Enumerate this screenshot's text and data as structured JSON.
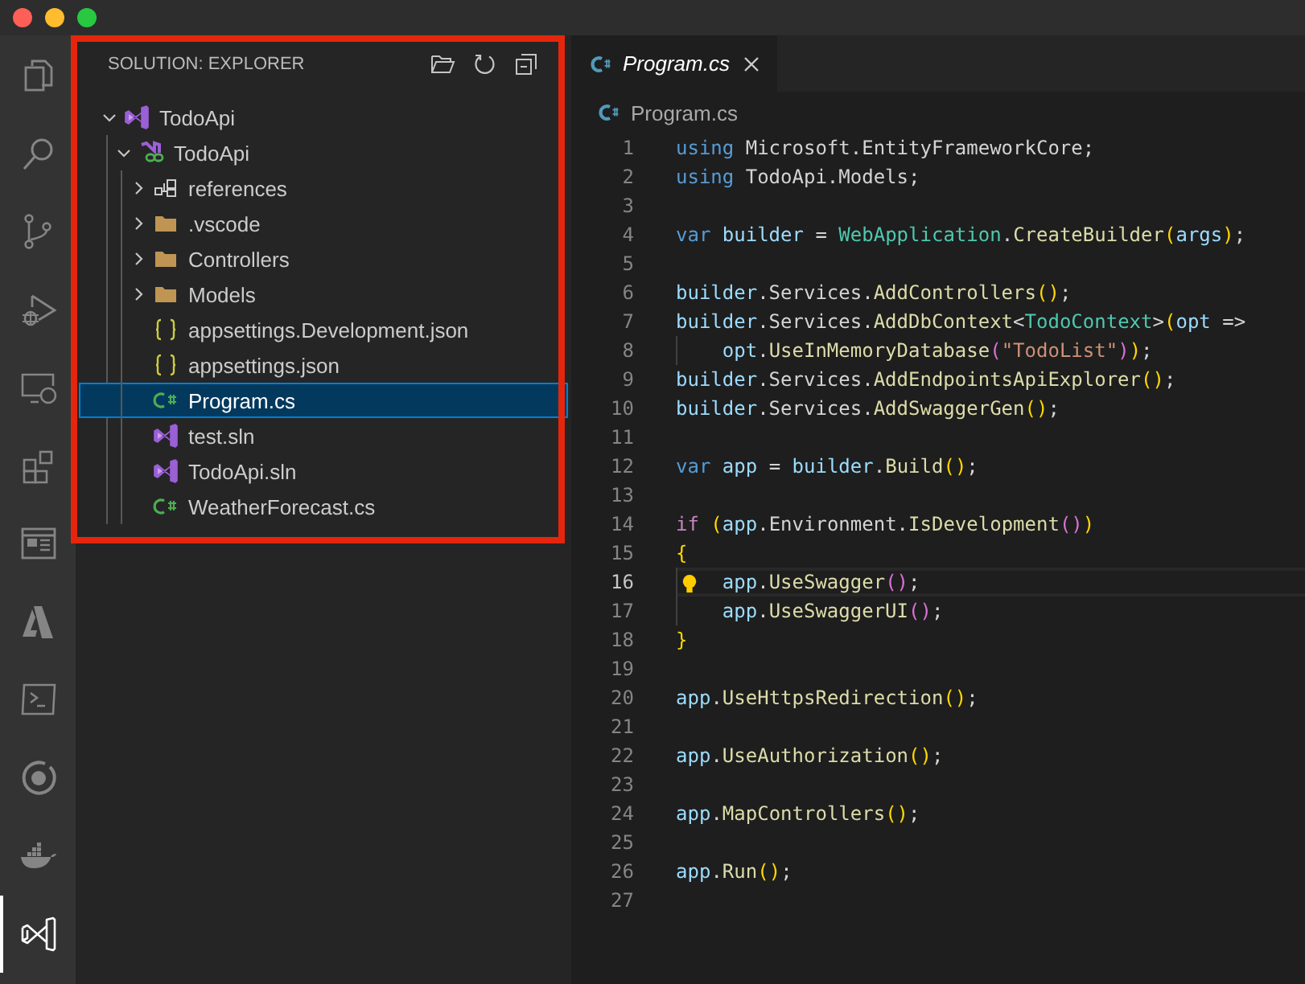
{
  "activity_bar": [
    {
      "kind": "files",
      "selected": false
    },
    {
      "kind": "search",
      "selected": false
    },
    {
      "kind": "source-control",
      "selected": false
    },
    {
      "kind": "run-debug",
      "selected": false
    },
    {
      "kind": "remote",
      "selected": false
    },
    {
      "kind": "extensions",
      "selected": false
    },
    {
      "kind": "layout",
      "selected": false
    },
    {
      "kind": "azure",
      "selected": false
    },
    {
      "kind": "terminal",
      "selected": false
    },
    {
      "kind": "ring",
      "selected": false
    },
    {
      "kind": "docker",
      "selected": false
    },
    {
      "kind": "solution",
      "selected": true
    }
  ],
  "sidebar": {
    "title": "SOLUTION: EXPLORER",
    "tree": [
      {
        "label": "TodoApi",
        "kind": "solution",
        "expanded": true,
        "selected": false,
        "children": [
          {
            "label": "TodoApi",
            "kind": "project",
            "expanded": true,
            "selected": false,
            "children": [
              {
                "label": "references",
                "kind": "references",
                "expanded": false,
                "selected": false
              },
              {
                "label": ".vscode",
                "kind": "folder",
                "expanded": false,
                "selected": false
              },
              {
                "label": "Controllers",
                "kind": "folder",
                "expanded": false,
                "selected": false
              },
              {
                "label": "Models",
                "kind": "folder",
                "expanded": false,
                "selected": false
              },
              {
                "label": "appsettings.Development.json",
                "kind": "json",
                "selected": false
              },
              {
                "label": "appsettings.json",
                "kind": "json",
                "selected": false
              },
              {
                "label": "Program.cs",
                "kind": "csharp",
                "selected": true
              },
              {
                "label": "test.sln",
                "kind": "solution",
                "selected": false
              },
              {
                "label": "TodoApi.sln",
                "kind": "solution",
                "selected": false
              },
              {
                "label": "WeatherForecast.cs",
                "kind": "csharp",
                "selected": false
              }
            ]
          }
        ]
      }
    ]
  },
  "editor": {
    "tabs": [
      {
        "label": "Program.cs",
        "selected": true
      }
    ],
    "breadcrumb": "Program.cs",
    "lines": [
      {
        "number": "1",
        "current": false,
        "indented": false,
        "tokens": [
          {
            "text": "using",
            "kind": "keyword"
          },
          {
            "text": " Microsoft.EntityFrameworkCore;",
            "kind": "plain"
          }
        ]
      },
      {
        "number": "2",
        "current": false,
        "indented": false,
        "tokens": [
          {
            "text": "using",
            "kind": "keyword"
          },
          {
            "text": " TodoApi.Models;",
            "kind": "plain"
          }
        ]
      },
      {
        "number": "3",
        "current": false,
        "indented": false
      },
      {
        "number": "4",
        "current": false,
        "indented": false,
        "tokens": [
          {
            "text": "var",
            "kind": "keyword"
          },
          {
            "text": " builder",
            "kind": "variable"
          },
          {
            "text": " = ",
            "kind": "plain"
          },
          {
            "text": "WebApplication",
            "kind": "type"
          },
          {
            "text": ".",
            "kind": "plain"
          },
          {
            "text": "CreateBuilder",
            "kind": "method"
          },
          {
            "text": "(",
            "kind": "bracket"
          },
          {
            "text": "args",
            "kind": "variable"
          },
          {
            "text": ")",
            "kind": "bracket"
          },
          {
            "text": ";",
            "kind": "plain"
          }
        ]
      },
      {
        "number": "5",
        "current": false,
        "indented": false
      },
      {
        "number": "6",
        "current": false,
        "indented": false,
        "tokens": [
          {
            "text": "builder",
            "kind": "variable"
          },
          {
            "text": ".Services.",
            "kind": "plain"
          },
          {
            "text": "AddControllers",
            "kind": "method"
          },
          {
            "text": "()",
            "kind": "bracket"
          },
          {
            "text": ";",
            "kind": "plain"
          }
        ]
      },
      {
        "number": "7",
        "current": false,
        "indented": false,
        "tokens": [
          {
            "text": "builder",
            "kind": "variable"
          },
          {
            "text": ".Services.",
            "kind": "plain"
          },
          {
            "text": "AddDbContext",
            "kind": "method"
          },
          {
            "text": "<",
            "kind": "plain"
          },
          {
            "text": "TodoContext",
            "kind": "type"
          },
          {
            "text": ">",
            "kind": "plain"
          },
          {
            "text": "(",
            "kind": "bracket"
          },
          {
            "text": "opt",
            "kind": "variable"
          },
          {
            "text": " =>",
            "kind": "plain"
          }
        ]
      },
      {
        "number": "8",
        "current": false,
        "indented": true,
        "tokens": [
          {
            "text": "opt",
            "kind": "variable"
          },
          {
            "text": ".",
            "kind": "plain"
          },
          {
            "text": "UseInMemoryDatabase",
            "kind": "method"
          },
          {
            "text": "(",
            "kind": "bracket2"
          },
          {
            "text": "\"TodoList\"",
            "kind": "string"
          },
          {
            "text": ")",
            "kind": "bracket2"
          },
          {
            "text": ")",
            "kind": "bracket"
          },
          {
            "text": ";",
            "kind": "plain"
          }
        ]
      },
      {
        "number": "9",
        "current": false,
        "indented": false,
        "tokens": [
          {
            "text": "builder",
            "kind": "variable"
          },
          {
            "text": ".Services.",
            "kind": "plain"
          },
          {
            "text": "AddEndpointsApiExplorer",
            "kind": "method"
          },
          {
            "text": "()",
            "kind": "bracket"
          },
          {
            "text": ";",
            "kind": "plain"
          }
        ]
      },
      {
        "number": "10",
        "current": false,
        "indented": false,
        "tokens": [
          {
            "text": "builder",
            "kind": "variable"
          },
          {
            "text": ".Services.",
            "kind": "plain"
          },
          {
            "text": "AddSwaggerGen",
            "kind": "method"
          },
          {
            "text": "()",
            "kind": "bracket"
          },
          {
            "text": ";",
            "kind": "plain"
          }
        ]
      },
      {
        "number": "11",
        "current": false,
        "indented": false
      },
      {
        "number": "12",
        "current": false,
        "indented": false,
        "tokens": [
          {
            "text": "var",
            "kind": "keyword"
          },
          {
            "text": " app",
            "kind": "variable"
          },
          {
            "text": " = ",
            "kind": "plain"
          },
          {
            "text": "builder",
            "kind": "variable"
          },
          {
            "text": ".",
            "kind": "plain"
          },
          {
            "text": "Build",
            "kind": "method"
          },
          {
            "text": "()",
            "kind": "bracket"
          },
          {
            "text": ";",
            "kind": "plain"
          }
        ]
      },
      {
        "number": "13",
        "current": false,
        "indented": false
      },
      {
        "number": "14",
        "current": false,
        "indented": false,
        "tokens": [
          {
            "text": "if",
            "kind": "control"
          },
          {
            "text": " (",
            "kind": "bracket"
          },
          {
            "text": "app",
            "kind": "variable"
          },
          {
            "text": ".Environment.",
            "kind": "plain"
          },
          {
            "text": "IsDevelopment",
            "kind": "method"
          },
          {
            "text": "()",
            "kind": "bracket2"
          },
          {
            "text": ")",
            "kind": "bracket"
          }
        ]
      },
      {
        "number": "15",
        "current": false,
        "indented": false,
        "tokens": [
          {
            "text": "{",
            "kind": "bracket"
          }
        ]
      },
      {
        "number": "16",
        "current": true,
        "indented": true,
        "tokens": [
          {
            "text": "app",
            "kind": "variable"
          },
          {
            "text": ".",
            "kind": "plain"
          },
          {
            "text": "UseSwagger",
            "kind": "method"
          },
          {
            "text": "()",
            "kind": "bracket2"
          },
          {
            "text": ";",
            "kind": "plain"
          }
        ]
      },
      {
        "number": "17",
        "current": false,
        "indented": true,
        "tokens": [
          {
            "text": "app",
            "kind": "variable"
          },
          {
            "text": ".",
            "kind": "plain"
          },
          {
            "text": "UseSwaggerUI",
            "kind": "method"
          },
          {
            "text": "()",
            "kind": "bracket2"
          },
          {
            "text": ";",
            "kind": "plain"
          }
        ]
      },
      {
        "number": "18",
        "current": false,
        "indented": false,
        "tokens": [
          {
            "text": "}",
            "kind": "bracket"
          }
        ]
      },
      {
        "number": "19",
        "current": false,
        "indented": false
      },
      {
        "number": "20",
        "current": false,
        "indented": false,
        "tokens": [
          {
            "text": "app",
            "kind": "variable"
          },
          {
            "text": ".",
            "kind": "plain"
          },
          {
            "text": "UseHttpsRedirection",
            "kind": "method"
          },
          {
            "text": "()",
            "kind": "bracket"
          },
          {
            "text": ";",
            "kind": "plain"
          }
        ]
      },
      {
        "number": "21",
        "current": false,
        "indented": false
      },
      {
        "number": "22",
        "current": false,
        "indented": false,
        "tokens": [
          {
            "text": "app",
            "kind": "variable"
          },
          {
            "text": ".",
            "kind": "plain"
          },
          {
            "text": "UseAuthorization",
            "kind": "method"
          },
          {
            "text": "()",
            "kind": "bracket"
          },
          {
            "text": ";",
            "kind": "plain"
          }
        ]
      },
      {
        "number": "23",
        "current": false,
        "indented": false
      },
      {
        "number": "24",
        "current": false,
        "indented": false,
        "tokens": [
          {
            "text": "app",
            "kind": "variable"
          },
          {
            "text": ".",
            "kind": "plain"
          },
          {
            "text": "MapControllers",
            "kind": "method"
          },
          {
            "text": "()",
            "kind": "bracket"
          },
          {
            "text": ";",
            "kind": "plain"
          }
        ]
      },
      {
        "number": "25",
        "current": false,
        "indented": false
      },
      {
        "number": "26",
        "current": false,
        "indented": false,
        "tokens": [
          {
            "text": "app",
            "kind": "variable"
          },
          {
            "text": ".",
            "kind": "plain"
          },
          {
            "text": "Run",
            "kind": "method"
          },
          {
            "text": "()",
            "kind": "bracket"
          },
          {
            "text": ";",
            "kind": "plain"
          }
        ]
      },
      {
        "number": "27",
        "current": false,
        "indented": false
      }
    ]
  }
}
